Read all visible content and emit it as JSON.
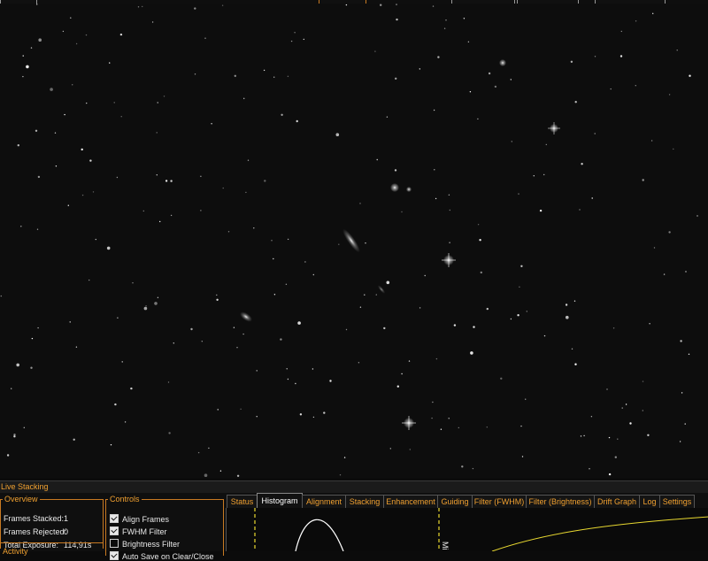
{
  "panel": {
    "title": "Live Stacking"
  },
  "overview": {
    "legend": "Overview",
    "frames_stacked_label": "Frames Stacked:",
    "frames_stacked": "1",
    "frames_rejected_label": "Frames Rejected:",
    "frames_rejected": "0",
    "total_exposure_label": "Total Exposure:",
    "total_exposure": "114,91s",
    "activity_label": "Activity"
  },
  "controls": {
    "legend": "Controls",
    "items": [
      {
        "label": "Align Frames",
        "checked": true
      },
      {
        "label": "FWHM Filter",
        "checked": true
      },
      {
        "label": "Brightness Filter",
        "checked": false
      },
      {
        "label": "Auto Save on Clear/Close",
        "checked": true
      }
    ]
  },
  "tabs": [
    {
      "label": "Status",
      "active": false
    },
    {
      "label": "Histogram",
      "active": true
    },
    {
      "label": "Alignment",
      "active": false
    },
    {
      "label": "Stacking",
      "active": false
    },
    {
      "label": "Enhancement",
      "active": false
    },
    {
      "label": "Guiding",
      "active": false
    },
    {
      "label": "Filter (FWHM)",
      "active": false
    },
    {
      "label": "Filter (Brightness)",
      "active": false
    },
    {
      "label": "Drift Graph",
      "active": false
    },
    {
      "label": "Log",
      "active": false
    },
    {
      "label": "Settings",
      "active": false
    }
  ],
  "histogram": {
    "marker_label": "Mi"
  },
  "colors": {
    "accent": "#f0a030",
    "border": "#c87a22",
    "background": "#0f0f0f",
    "curve": "#e8d830",
    "marker": "#e8d830"
  }
}
